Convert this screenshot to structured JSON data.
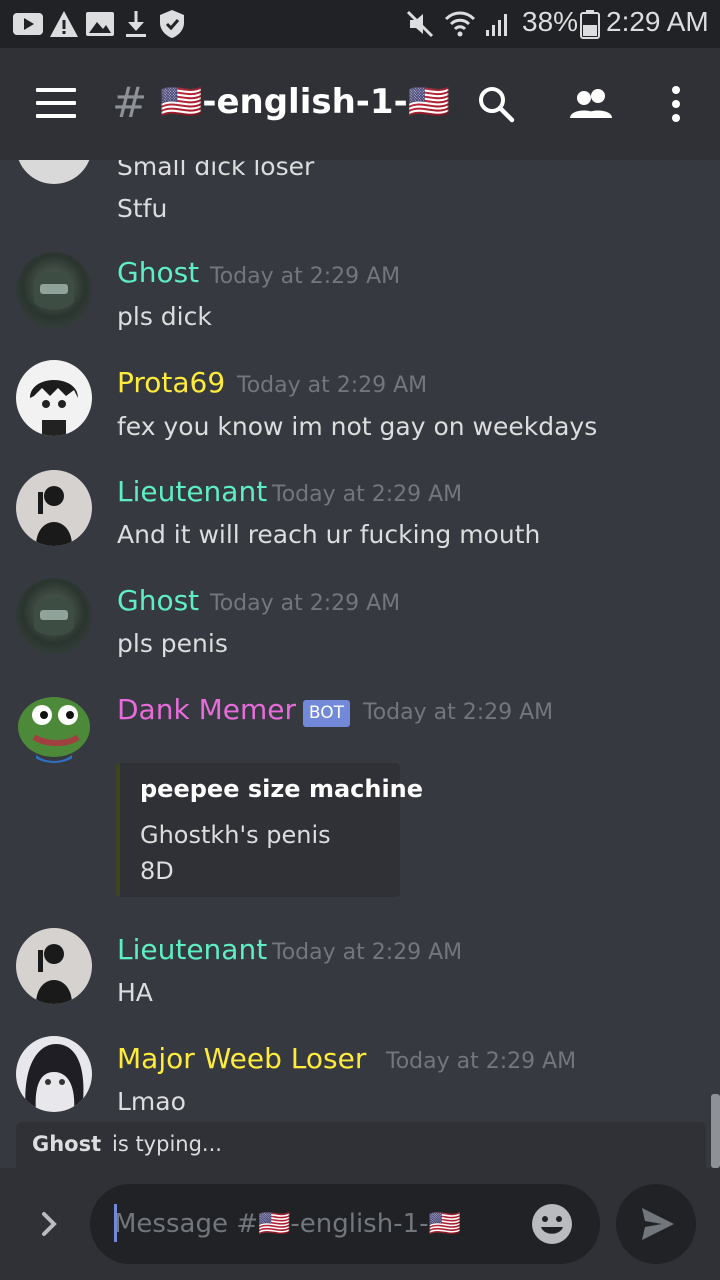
{
  "status_bar": {
    "battery": "38%",
    "time": "2:29 AM"
  },
  "header": {
    "hash": "#",
    "channel": "🇺🇸-english-1-🇺🇸"
  },
  "colors": {
    "background": "#36393f",
    "header": "#2f3136",
    "statusbar": "#202225",
    "teal_name": "#5eeec3",
    "yellow_name": "#ffeb3b",
    "pink_name": "#e76bdb",
    "bot_badge": "#7289da",
    "timestamp": "#72767d"
  },
  "messages": [
    {
      "author": "",
      "lines": [
        "Small dick loser",
        "Stfu"
      ]
    },
    {
      "author": "Ghost",
      "time": "Today at 2:29 AM",
      "text": "pls dick"
    },
    {
      "author": "Prota69",
      "time": "Today at 2:29 AM",
      "text": "fex you know im not gay on weekdays"
    },
    {
      "author": "Lieutenant",
      "time": "Today at 2:29 AM",
      "text": "And it will reach ur fucking mouth"
    },
    {
      "author": "Ghost",
      "time": "Today at 2:29 AM",
      "text": "pls penis"
    },
    {
      "author": "Dank Memer",
      "badge": "BOT",
      "time": "Today at 2:29 AM",
      "embed": {
        "title": "peepee size machine",
        "line1": "Ghostkh's penis",
        "line2": "8D"
      }
    },
    {
      "author": "Lieutenant",
      "time": "Today at 2:29 AM",
      "text": "HA"
    },
    {
      "author": "Major  Weeb Loser",
      "time": "Today at 2:29 AM",
      "text": "Lmao"
    }
  ],
  "typing": {
    "name": "Ghost",
    "text": "is typing..."
  },
  "composer": {
    "placeholder": "Message #🇺🇸-english-1-🇺🇸"
  }
}
